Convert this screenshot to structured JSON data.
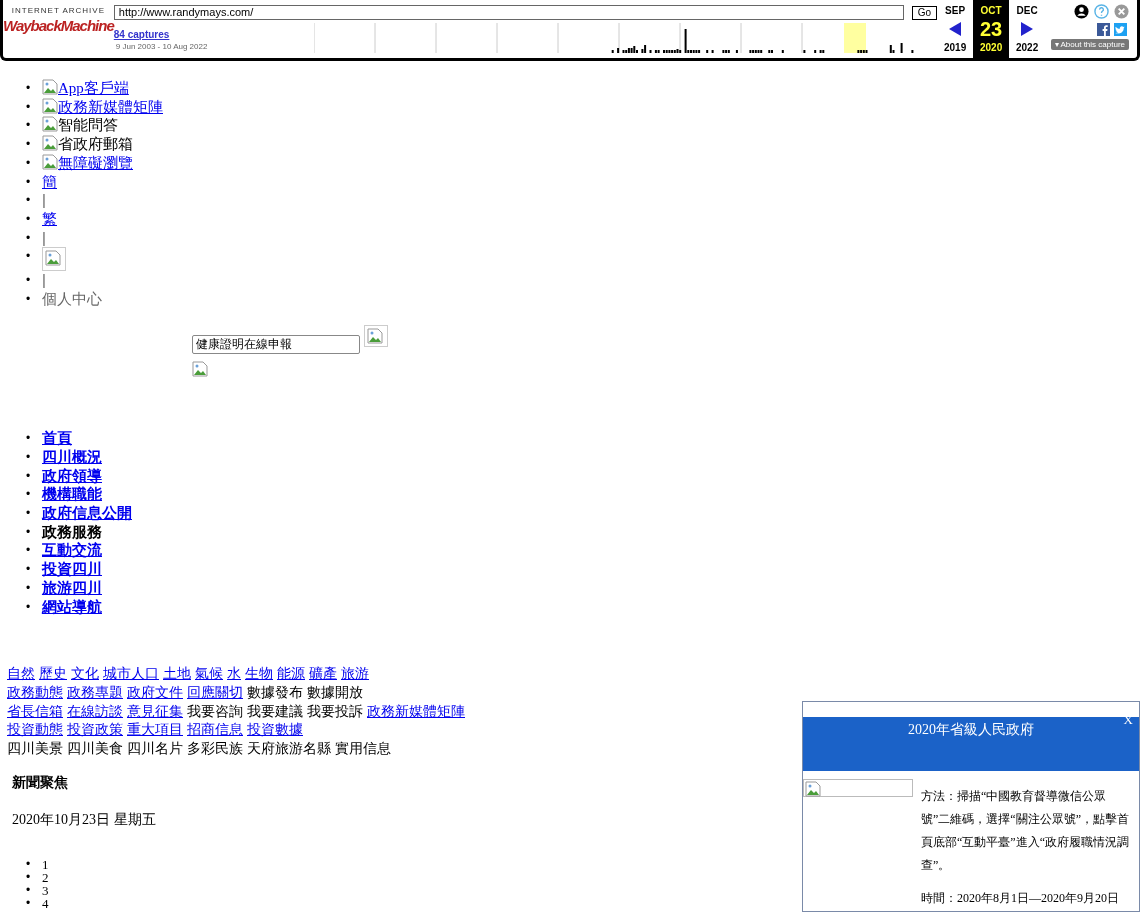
{
  "toolbar": {
    "logo_top": "INTERNET ARCHIVE",
    "logo_main": "WaybackMachine",
    "url": "http://www.randymays.com/",
    "go": "Go",
    "captures": "84 captures",
    "date_range": "9 Jun 2003 - 10 Aug 2022",
    "months": [
      {
        "month": "SEP",
        "year": "2019",
        "selected": false
      },
      {
        "month": "OCT",
        "year": "2020",
        "selected": true
      },
      {
        "month": "DEC",
        "year": "2022",
        "selected": false
      }
    ],
    "day": "23",
    "about_caret": "▾",
    "about": "About this capture"
  },
  "bullet": "•",
  "top_links": [
    {
      "kind": "icon_link",
      "text": "App客戶端"
    },
    {
      "kind": "icon_link",
      "text": "政務新媒體矩陣"
    },
    {
      "kind": "icon_text",
      "text": "智能問答"
    },
    {
      "kind": "icon_text",
      "text": "省政府郵箱"
    },
    {
      "kind": "icon_link",
      "text": "無障礙瀏覽"
    },
    {
      "kind": "link",
      "text": "簡"
    },
    {
      "kind": "text",
      "text": "|"
    },
    {
      "kind": "link",
      "text": "繁"
    },
    {
      "kind": "text",
      "text": "|"
    },
    {
      "kind": "image"
    },
    {
      "kind": "text",
      "text": "|"
    },
    {
      "kind": "text",
      "text": "個人中心"
    }
  ],
  "search": {
    "value": "健康證明在線申報"
  },
  "nav": [
    {
      "label": "首頁",
      "link": true
    },
    {
      "label": "四川概況",
      "link": true
    },
    {
      "label": "政府領導",
      "link": true
    },
    {
      "label": "機構職能",
      "link": true
    },
    {
      "label": "政府信息公開",
      "link": true
    },
    {
      "label": "政務服務",
      "link": false
    },
    {
      "label": "互動交流",
      "link": true
    },
    {
      "label": "投資四川",
      "link": true
    },
    {
      "label": "旅游四川",
      "link": true
    },
    {
      "label": "網站導航",
      "link": true
    }
  ],
  "link_rows": [
    [
      {
        "text": "自然",
        "link": true
      },
      {
        "text": "歷史",
        "link": true
      },
      {
        "text": "文化",
        "link": true
      },
      {
        "text": "城市人口",
        "link": true
      },
      {
        "text": "土地",
        "link": true
      },
      {
        "text": "氣候",
        "link": true
      },
      {
        "text": "水",
        "link": true
      },
      {
        "text": "生物",
        "link": true
      },
      {
        "text": "能源",
        "link": true
      },
      {
        "text": "礦產",
        "link": true
      },
      {
        "text": "旅游",
        "link": true
      }
    ],
    [
      {
        "text": "政務動態",
        "link": true
      },
      {
        "text": "政務專題",
        "link": true
      },
      {
        "text": "政府文件",
        "link": true
      },
      {
        "text": "回應關切",
        "link": true
      },
      {
        "text": "數據發布",
        "link": false
      },
      {
        "text": "數據開放",
        "link": false
      }
    ],
    [
      {
        "text": "省長信箱",
        "link": true
      },
      {
        "text": "在線訪談",
        "link": true
      },
      {
        "text": "意見征集",
        "link": true
      },
      {
        "text": "我要咨詢",
        "link": false
      },
      {
        "text": "我要建議",
        "link": false
      },
      {
        "text": "我要投訴",
        "link": false
      },
      {
        "text": "政務新媒體矩陣",
        "link": true
      }
    ],
    [
      {
        "text": "投資動態",
        "link": true
      },
      {
        "text": "投資政策",
        "link": true
      },
      {
        "text": "重大項目",
        "link": true
      },
      {
        "text": "招商信息",
        "link": true
      },
      {
        "text": "投資數據",
        "link": true
      }
    ],
    [
      {
        "text": "四川美景",
        "link": false
      },
      {
        "text": "四川美食",
        "link": false
      },
      {
        "text": "四川名片",
        "link": false
      },
      {
        "text": "多彩民族",
        "link": false
      },
      {
        "text": "天府旅游名縣",
        "link": false
      },
      {
        "text": "實用信息",
        "link": false
      }
    ]
  ],
  "section_title": "新聞聚焦",
  "date": "2020年10月23日 星期五",
  "pager": [
    "1",
    "2",
    "3",
    "4"
  ],
  "popup": {
    "title": "2020年省級人民政府",
    "close": "X",
    "paragraphs": [
      "方法：掃描“中國教育督導微信公眾號”二維碼，選擇“關注公眾號”，點擊首頁底部“互動平臺”進入“政府履職情況調查”。",
      "時間：2020年8月1日—2020年9月20日"
    ]
  }
}
